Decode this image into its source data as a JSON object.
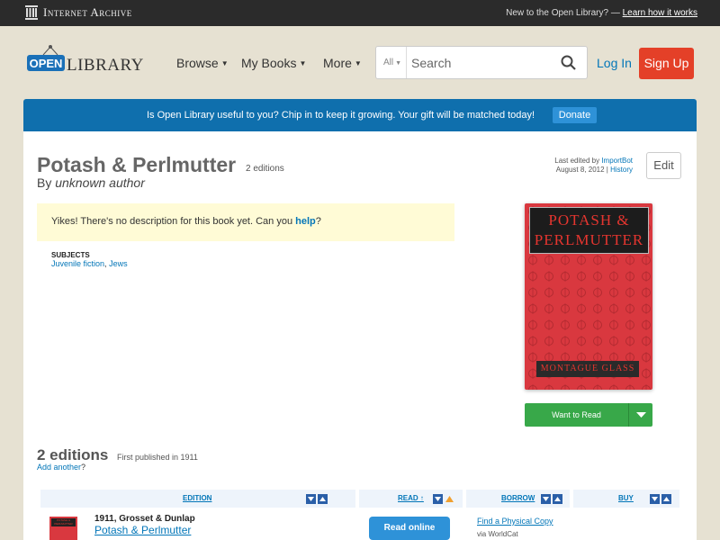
{
  "ia_bar": {
    "logo_text": "Internet Archive",
    "new_text": "New to the Open Library? —",
    "learn_link": "Learn how it works"
  },
  "header": {
    "logo_open": "OPEN",
    "logo_library": "LIBRARY",
    "nav": [
      {
        "label": "Browse"
      },
      {
        "label": "My Books"
      },
      {
        "label": "More"
      }
    ],
    "search": {
      "scope": "All",
      "placeholder": "Search"
    },
    "login": "Log In",
    "signup": "Sign Up"
  },
  "donate": {
    "text": "Is Open Library useful to you? Chip in to keep it growing. Your gift will be matched today!",
    "button": "Donate"
  },
  "work": {
    "title": "Potash & Perlmutter",
    "editions_count": "2 editions",
    "by": "By",
    "author": "unknown author",
    "last_edited_prefix": "Last edited by",
    "last_edited_by": "ImportBot",
    "last_edited_date": "August 8, 2012",
    "history": "History",
    "edit": "Edit",
    "desc_text": "Yikes! There's no description for this book yet. Can you",
    "desc_help": "help",
    "desc_end": "?",
    "subjects_heading": "SUBJECTS",
    "subjects": [
      "Juvenile fiction",
      "Jews"
    ],
    "cover_title_1": "POTASH &",
    "cover_title_2": "PERLMUTTER",
    "cover_author": "MONTAGUE GLASS",
    "want_to_read": "Want to Read"
  },
  "editions": {
    "heading": "2 editions",
    "first_published": "First published in 1911",
    "add_another": "Add another",
    "add_another_end": "?",
    "columns": {
      "edition": "EDITION",
      "read": "READ ↑",
      "borrow": "BORROW",
      "buy": "BUY"
    },
    "rows": [
      {
        "publisher": "1911, Grosset & Dunlap",
        "title": "Potash & Perlmutter",
        "read_button": "Read online",
        "find_copy": "Find a Physical Copy",
        "via": "via WorldCat",
        "thumb_text": "POTASH & PERLMUTTER"
      }
    ]
  },
  "colors": {
    "ia_bar": "#2b2b2b",
    "background": "#e6e1d2",
    "donate_banner": "#0f6fad",
    "signup": "#e44028",
    "want_to_read": "#38a849",
    "read_online": "#2e92d8",
    "link": "#0376b8",
    "cover": "#d9383f"
  }
}
